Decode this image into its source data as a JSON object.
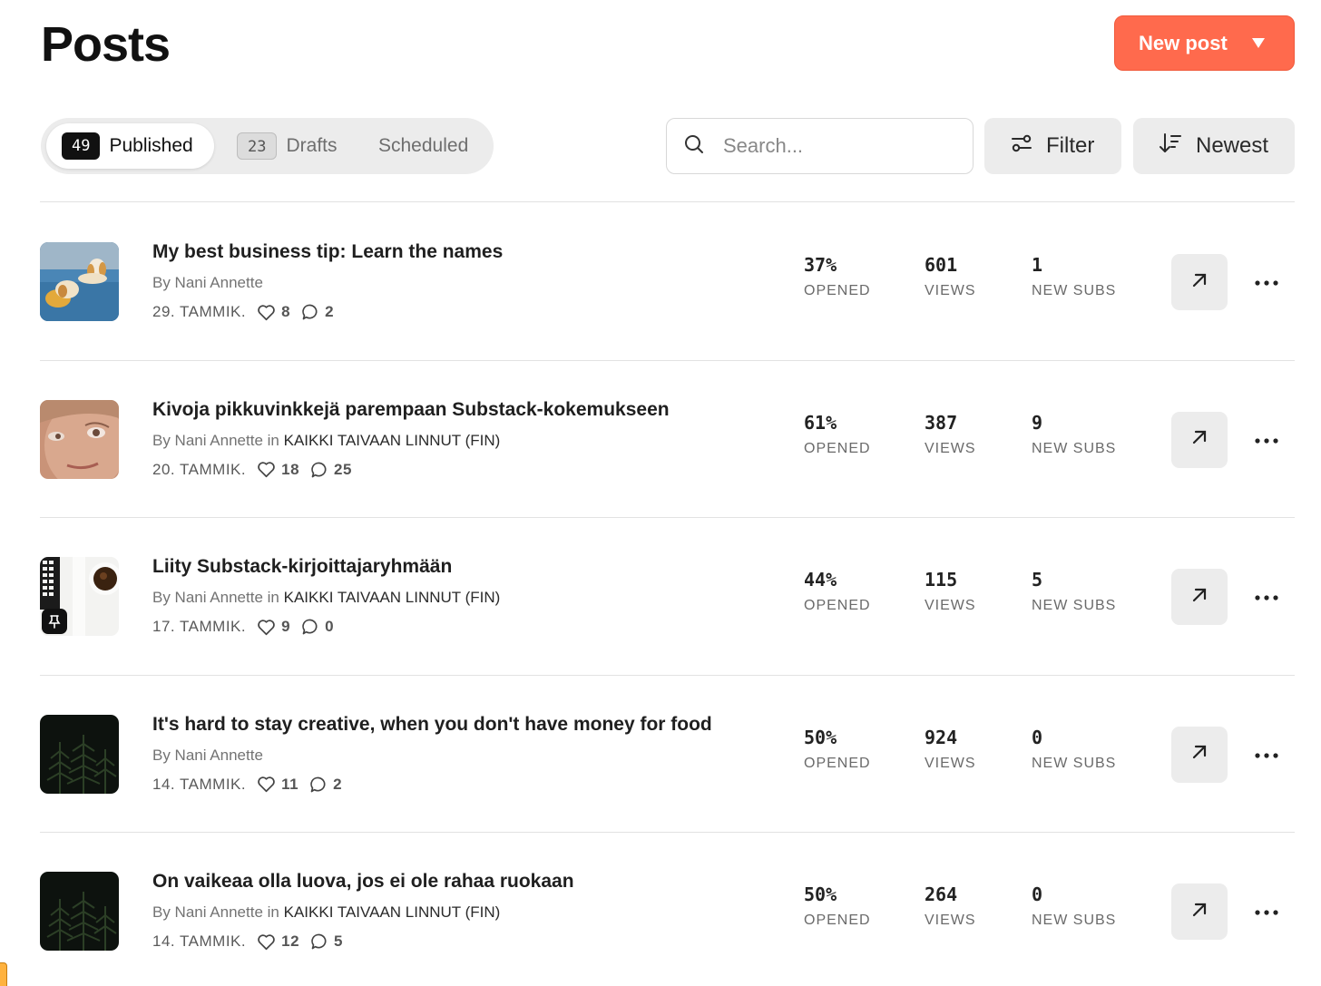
{
  "header": {
    "title": "Posts",
    "new_post_label": "New post"
  },
  "tabs": [
    {
      "count": "49",
      "label": "Published",
      "active": true
    },
    {
      "count": "23",
      "label": "Drafts",
      "active": false
    },
    {
      "label": "Scheduled",
      "active": false
    }
  ],
  "search": {
    "placeholder": "Search...",
    "value": ""
  },
  "toolbar": {
    "filter_label": "Filter",
    "sort_label": "Newest"
  },
  "colors": {
    "accent": "#ff6a4d",
    "button_gray": "#ececec"
  },
  "posts": [
    {
      "title": "My best business tip: Learn the names",
      "by": "By Nani Annette",
      "in_word": "",
      "publication": "",
      "date": "29. TAMMIK.",
      "likes": "8",
      "comments": "2",
      "opened": "37%",
      "opened_label": "OPENED",
      "views": "601",
      "views_label": "VIEWS",
      "subs": "1",
      "subs_label": "NEW SUBS",
      "thumb": "dog-on-couch",
      "pinned": false
    },
    {
      "title": "Kivoja pikkuvinkkejä parempaan Substack-kokemukseen",
      "by": "By Nani Annette",
      "in_word": "in",
      "publication": "KAIKKI TAIVAAN LINNUT (FIN)",
      "date": "20. TAMMIK.",
      "likes": "18",
      "comments": "25",
      "opened": "61%",
      "opened_label": "OPENED",
      "views": "387",
      "views_label": "VIEWS",
      "subs": "9",
      "subs_label": "NEW SUBS",
      "thumb": "face-closeup",
      "pinned": false
    },
    {
      "title": "Liity Substack-kirjoittajaryhmään",
      "by": "By Nani Annette",
      "in_word": "in",
      "publication": "KAIKKI TAIVAAN LINNUT (FIN)",
      "date": "17. TAMMIK.",
      "likes": "9",
      "comments": "0",
      "opened": "44%",
      "opened_label": "OPENED",
      "views": "115",
      "views_label": "VIEWS",
      "subs": "5",
      "subs_label": "NEW SUBS",
      "thumb": "keyboard-and-coffee",
      "pinned": true
    },
    {
      "title": "It's hard to stay creative, when you don't have money for food",
      "by": "By Nani Annette",
      "in_word": "",
      "publication": "",
      "date": "14. TAMMIK.",
      "likes": "11",
      "comments": "2",
      "opened": "50%",
      "opened_label": "OPENED",
      "views": "924",
      "views_label": "VIEWS",
      "subs": "0",
      "subs_label": "NEW SUBS",
      "thumb": "dark-ferns",
      "pinned": false
    },
    {
      "title": "On vaikeaa olla luova, jos ei ole rahaa ruokaan",
      "by": "By Nani Annette",
      "in_word": "in",
      "publication": "KAIKKI TAIVAAN LINNUT (FIN)",
      "date": "14. TAMMIK.",
      "likes": "12",
      "comments": "5",
      "opened": "50%",
      "opened_label": "OPENED",
      "views": "264",
      "views_label": "VIEWS",
      "subs": "0",
      "subs_label": "NEW SUBS",
      "thumb": "dark-ferns",
      "pinned": false
    }
  ]
}
